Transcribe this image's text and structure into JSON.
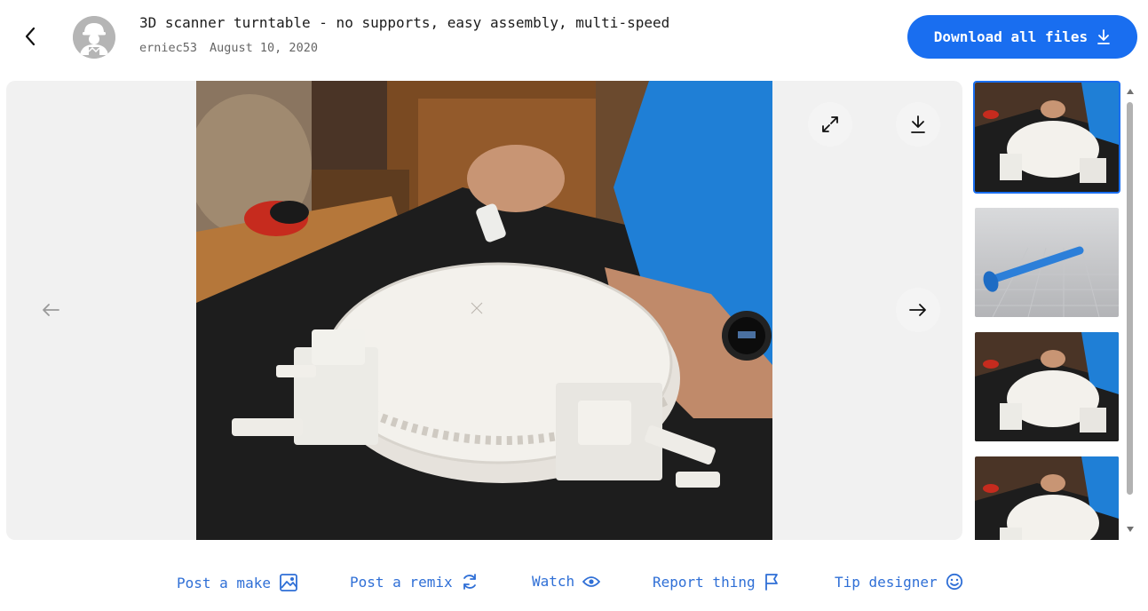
{
  "header": {
    "title": "3D scanner turntable - no supports, easy assembly, multi-speed",
    "author": "erniec53",
    "date": "August 10, 2020",
    "download_all_label": "Download all files"
  },
  "actions": {
    "post_make": "Post a make",
    "post_remix": "Post a remix",
    "watch": "Watch",
    "report": "Report thing",
    "tip": "Tip designer"
  },
  "thumbnails": [
    {
      "kind": "photo",
      "selected": true
    },
    {
      "kind": "render",
      "selected": false
    },
    {
      "kind": "photo",
      "selected": false
    },
    {
      "kind": "photo",
      "selected": false
    }
  ],
  "colors": {
    "accent": "#196ef0",
    "link": "#2f6fd6",
    "viewer_bg": "#f1f1f1"
  },
  "icons": [
    "back-arrow-icon",
    "avatar-icon",
    "download-icon",
    "expand-icon",
    "arrow-left-icon",
    "arrow-right-icon",
    "image-icon",
    "remix-icon",
    "eye-icon",
    "flag-icon",
    "smile-icon"
  ]
}
